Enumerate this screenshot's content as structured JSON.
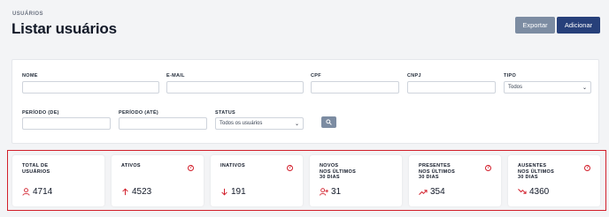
{
  "header": {
    "breadcrumb": "USUÁRIOS",
    "title": "Listar usuários",
    "export_label": "Exportar",
    "add_label": "Adicionar"
  },
  "filters": {
    "nome_label": "NOME",
    "email_label": "E-MAIL",
    "cpf_label": "CPF",
    "cnpj_label": "CNPJ",
    "tipo_label": "TIPO",
    "tipo_value": "Todos",
    "periodo_de_label": "PERÍODO (DE)",
    "periodo_ate_label": "PERÍODO (ATÉ)",
    "status_label": "STATUS",
    "status_value": "Todos os usuários"
  },
  "stats": [
    {
      "label": "TOTAL DE\nUSUÁRIOS",
      "value": "4714",
      "icon": "user-icon",
      "help": false
    },
    {
      "label": "ATIVOS",
      "value": "4523",
      "icon": "arrow-up-icon",
      "help": true
    },
    {
      "label": "INATIVOS",
      "value": "191",
      "icon": "arrow-down-icon",
      "help": true
    },
    {
      "label": "NOVOS\nNOS ÚLTIMOS\n30 DIAS",
      "value": "31",
      "icon": "user-plus-icon",
      "help": false
    },
    {
      "label": "PRESENTES\nNOS ÚLTIMOS\n30 DIAS",
      "value": "354",
      "icon": "trend-up-icon",
      "help": true
    },
    {
      "label": "AUSENTES\nNOS ÚLTIMOS\n30 DIAS",
      "value": "4360",
      "icon": "trend-down-icon",
      "help": true
    }
  ],
  "colors": {
    "accent_red": "#d21f2b",
    "primary": "#27407a",
    "secondary": "#7c8ca2"
  }
}
